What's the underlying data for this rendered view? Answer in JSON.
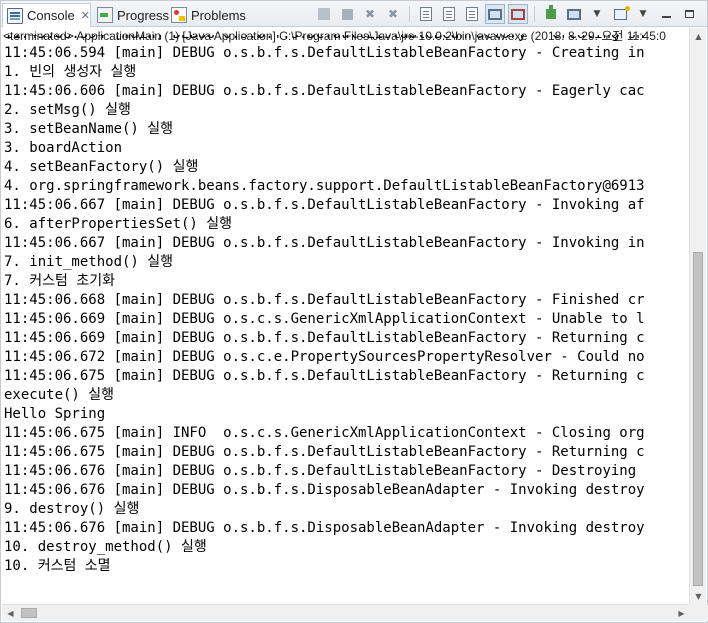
{
  "tabs": [
    {
      "label": "Console",
      "icon": "console-icon",
      "active": true
    },
    {
      "label": "Progress",
      "icon": "progress-icon"
    },
    {
      "label": "Problems",
      "icon": "problems-icon"
    }
  ],
  "close_glyph": "✕",
  "toolbar": {
    "icons": [
      "terminate-icon",
      "stop-icon",
      "remove-launch-icon",
      "remove-all-terminated-icon",
      "clear-console-icon",
      "scroll-lock-icon",
      "word-wrap-icon",
      "show-on-stdout-icon",
      "show-on-stderr-icon",
      "pin-console-icon",
      "display-selected-console-icon",
      "open-console-icon",
      "view-menu-icon",
      "minimize-icon",
      "maximize-icon"
    ]
  },
  "status": "<terminated> ApplicationMain (1) [Java Application] C:\\Program Files\\Java\\jre-10.0.2\\bin\\javaw.exe (2018. 8. 29. 오전 11:45:0",
  "lines": [
    "11:45:06.594 [main] DEBUG o.s.b.f.s.DefaultListableBeanFactory - Creating sh",
    "11:45:06.594 [main] DEBUG o.s.b.f.s.DefaultListableBeanFactory - Creating in",
    "1. 빈의 생성자 실행",
    "11:45:06.606 [main] DEBUG o.s.b.f.s.DefaultListableBeanFactory - Eagerly cac",
    "2. setMsg() 실행",
    "3. setBeanName() 실행",
    "3. boardAction",
    "4. setBeanFactory() 실행",
    "4. org.springframework.beans.factory.support.DefaultListableBeanFactory@6913",
    "11:45:06.667 [main] DEBUG o.s.b.f.s.DefaultListableBeanFactory - Invoking af",
    "6. afterPropertiesSet() 실행",
    "11:45:06.667 [main] DEBUG o.s.b.f.s.DefaultListableBeanFactory - Invoking in",
    "7. init_method() 실행",
    "7. 커스텀 초기화",
    "11:45:06.668 [main] DEBUG o.s.b.f.s.DefaultListableBeanFactory - Finished cr",
    "11:45:06.669 [main] DEBUG o.s.c.s.GenericXmlApplicationContext - Unable to l",
    "11:45:06.669 [main] DEBUG o.s.b.f.s.DefaultListableBeanFactory - Returning c",
    "11:45:06.672 [main] DEBUG o.s.c.e.PropertySourcesPropertyResolver - Could no",
    "11:45:06.675 [main] DEBUG o.s.b.f.s.DefaultListableBeanFactory - Returning c",
    "execute() 실행",
    "Hello Spring",
    "11:45:06.675 [main] INFO  o.s.c.s.GenericXmlApplicationContext - Closing org",
    "11:45:06.675 [main] DEBUG o.s.b.f.s.DefaultListableBeanFactory - Returning c",
    "11:45:06.676 [main] DEBUG o.s.b.f.s.DefaultListableBeanFactory - Destroying",
    "11:45:06.676 [main] DEBUG o.s.b.f.s.DisposableBeanAdapter - Invoking destroy",
    "9. destroy() 실행",
    "11:45:06.676 [main] DEBUG o.s.b.f.s.DisposableBeanAdapter - Invoking destroy",
    "10. destroy_method() 실행",
    "10. 커스텀 소멸"
  ]
}
